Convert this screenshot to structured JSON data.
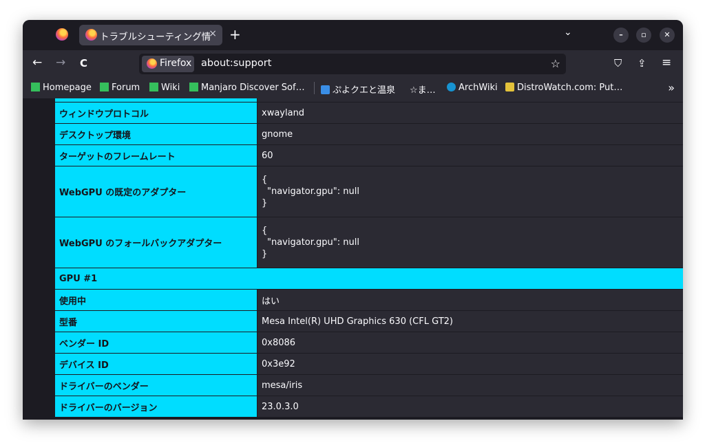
{
  "tab": {
    "title": "トラブルシューティング情報",
    "close": "×"
  },
  "toolbar": {
    "new_tab": "+",
    "list_all_tabs": "⌄",
    "back": "←",
    "forward": "→",
    "reload": "C",
    "identity_label": "Firefox",
    "url": "about:support",
    "bookmark_star": "☆",
    "pocket": "⛉",
    "share": "⇪",
    "menu": "≡"
  },
  "window_controls": {
    "minimize": "–",
    "maximize": "▫",
    "close": "✕"
  },
  "bookmarks": [
    {
      "label": "Homepage",
      "color": "#35bf5c"
    },
    {
      "label": "Forum",
      "color": "#35bf5c"
    },
    {
      "label": "Wiki",
      "color": "#35bf5c"
    },
    {
      "label": "Manjaro Discover Sof…",
      "color": "#35bf5c"
    },
    {
      "label": "ぷよクエと温泉",
      "color": "#3a8ee6"
    },
    {
      "label": "☆ま…",
      "color": ""
    },
    {
      "label": "ArchWiki",
      "color": "#1793d1"
    },
    {
      "label": "DistroWatch.com: Put…",
      "color": "#e3c23b"
    }
  ],
  "bookmarks_more": "»",
  "table": {
    "rows": [
      {
        "key": "ウィンドウプロトコル",
        "value": "xwayland"
      },
      {
        "key": "デスクトップ環境",
        "value": "gnome"
      },
      {
        "key": "ターゲットのフレームレート",
        "value": "60"
      },
      {
        "key": "WebGPU の既定のアダプター",
        "lines": [
          "{",
          "\"navigator.gpu\": null",
          "}"
        ]
      },
      {
        "key": "WebGPU のフォールバックアダプター",
        "lines": [
          "{",
          "\"navigator.gpu\": null",
          "}"
        ]
      }
    ],
    "section_header": "GPU #1",
    "gpu_rows": [
      {
        "key": "使用中",
        "value": "はい"
      },
      {
        "key": "型番",
        "value": "Mesa Intel(R) UHD Graphics 630 (CFL GT2)"
      },
      {
        "key": "ベンダー ID",
        "value": "0x8086"
      },
      {
        "key": "デバイス ID",
        "value": "0x3e92"
      },
      {
        "key": "ドライバーのベンダー",
        "value": "mesa/iris"
      },
      {
        "key": "ドライバーのバージョン",
        "value": "23.0.3.0"
      }
    ]
  },
  "colors": {
    "accent": "#00ddff",
    "background": "#1c1b22",
    "cell": "#2b2a33"
  }
}
